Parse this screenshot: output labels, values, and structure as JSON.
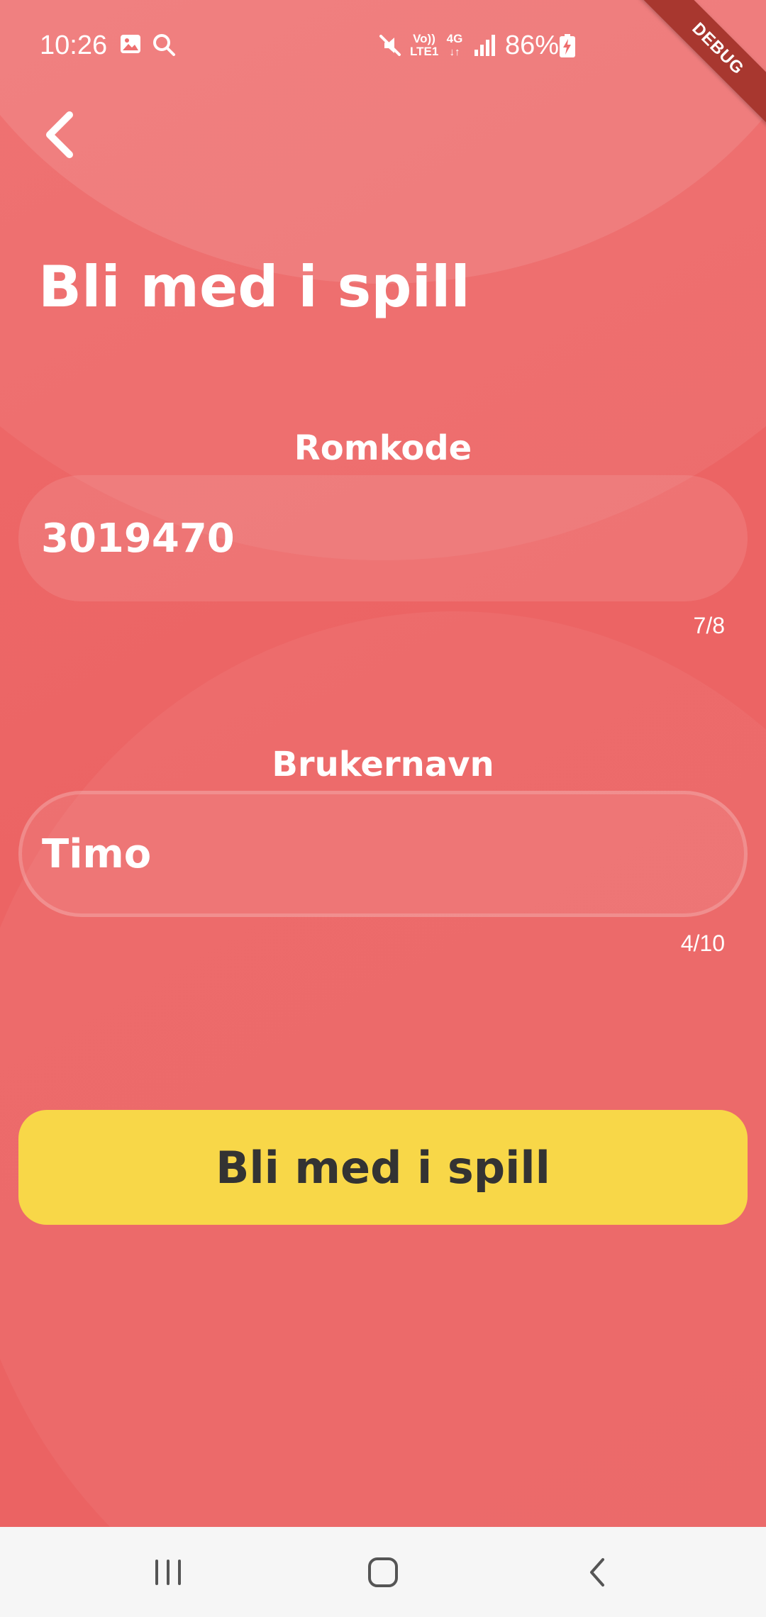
{
  "status_bar": {
    "time": "10:26",
    "battery": "86%",
    "network_volte": "Vo)) LTE1",
    "network_4g": "4G",
    "icons": [
      "image-icon",
      "search-icon",
      "mute-icon",
      "signal-icon",
      "battery-charging-icon"
    ]
  },
  "debug_banner": "DEBUG",
  "page": {
    "title": "Bli med i spill"
  },
  "room_code": {
    "label": "Romkode",
    "value": "3019470",
    "counter": "7/8"
  },
  "username": {
    "label": "Brukernavn",
    "value": "Timo",
    "counter": "4/10"
  },
  "join_button": {
    "label": "Bli med i spill",
    "color": "#f8d748"
  },
  "colors": {
    "background": "#ec6464",
    "accent": "#f8d748",
    "debug_ribbon": "#a8372f"
  },
  "nav_bar": {
    "icons": [
      "recents-icon",
      "home-icon",
      "nav-back-icon"
    ]
  }
}
